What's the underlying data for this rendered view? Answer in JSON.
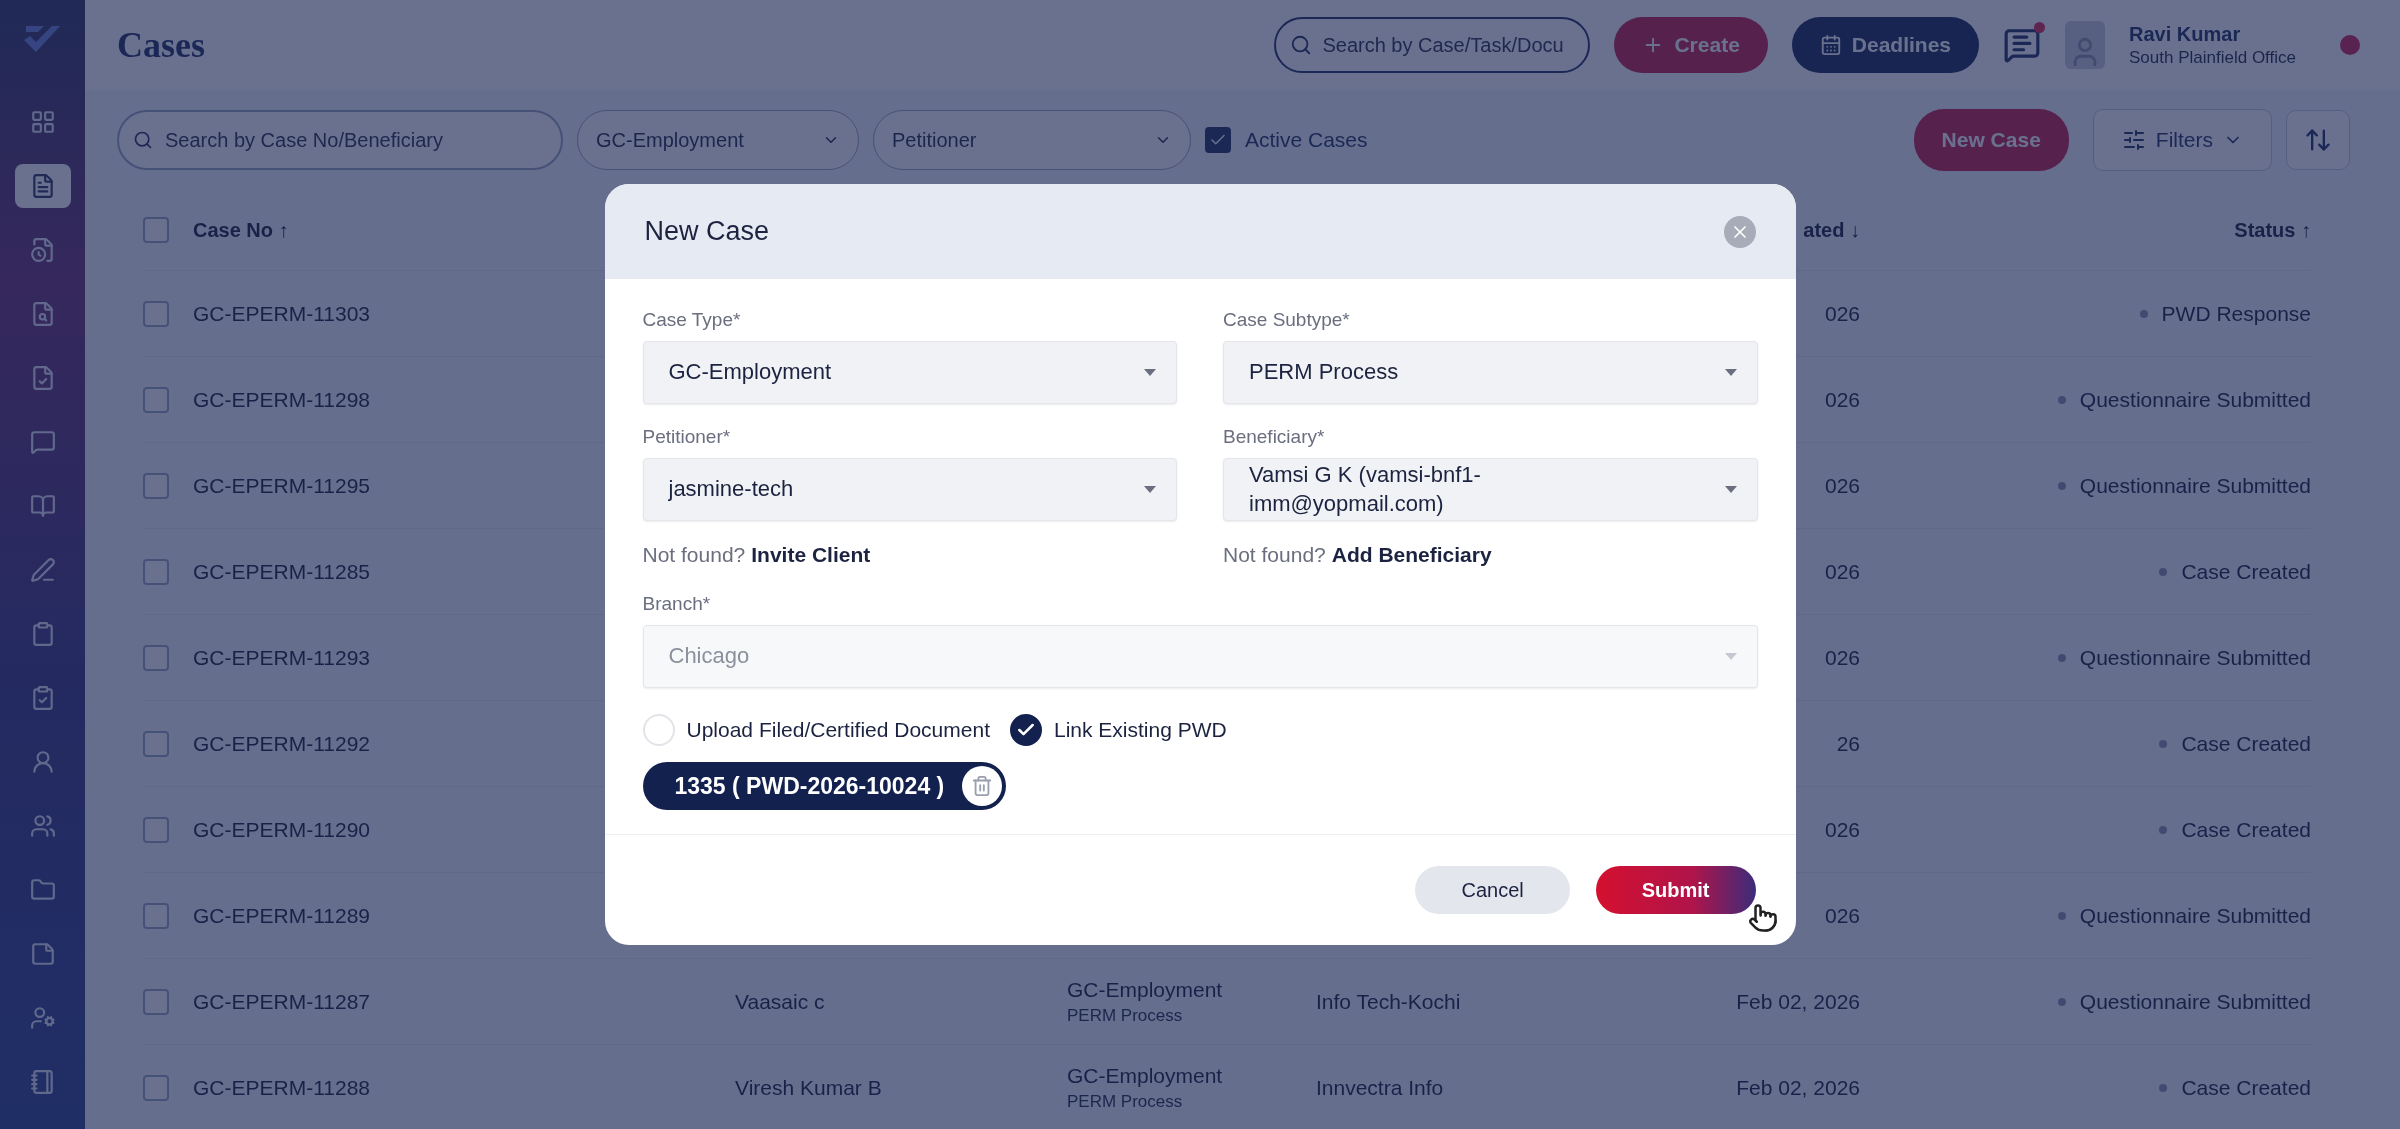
{
  "topbar": {
    "title": "Cases",
    "search": {
      "placeholder": "Search by Case/Task/Docu"
    },
    "create_button": "Create",
    "deadlines_button": "Deadlines",
    "chat": {
      "unread": true
    },
    "user": {
      "name": "Ravi Kumar",
      "office": "South Plainfield Office"
    }
  },
  "sidebar": {
    "items": [
      {
        "selected": false
      },
      {
        "selected": true
      },
      {
        "selected": false
      },
      {
        "selected": false
      },
      {
        "selected": false
      },
      {
        "selected": false
      },
      {
        "selected": false
      },
      {
        "selected": false
      },
      {
        "selected": false
      },
      {
        "selected": false
      },
      {
        "selected": false
      },
      {
        "selected": false
      },
      {
        "selected": false
      },
      {
        "selected": false
      },
      {
        "selected": false
      },
      {
        "selected": false
      }
    ]
  },
  "filters": {
    "search": {
      "placeholder": "Search by Case No/Beneficiary"
    },
    "case_type": {
      "value": "GC-Employment"
    },
    "petitioner": {
      "placeholder": "Petitioner"
    },
    "active_cases": {
      "label": "Active Cases",
      "checked": true
    },
    "new_case_button": "New Case",
    "filters_button": "Filters"
  },
  "table": {
    "columns": {
      "case_no": "Case No ↑",
      "created": "ated ↓",
      "status": "Status ↑"
    },
    "header_checked": false,
    "rows": [
      {
        "checked": false,
        "case_no": "GC-EPERM-11303",
        "created": "026",
        "status": "PWD Response"
      },
      {
        "checked": false,
        "case_no": "GC-EPERM-11298",
        "created": "026",
        "status": "Questionnaire Submitted"
      },
      {
        "checked": false,
        "case_no": "GC-EPERM-11295",
        "created": "026",
        "status": "Questionnaire Submitted"
      },
      {
        "checked": false,
        "case_no": "GC-EPERM-11285",
        "created": "026",
        "status": "Case Created"
      },
      {
        "checked": false,
        "case_no": "GC-EPERM-11293",
        "created": "026",
        "status": "Questionnaire Submitted"
      },
      {
        "checked": false,
        "case_no": "GC-EPERM-11292",
        "created": "26",
        "status": "Case Created"
      },
      {
        "checked": false,
        "case_no": "GC-EPERM-11290",
        "created": "026",
        "status": "Case Created"
      },
      {
        "checked": false,
        "case_no": "GC-EPERM-11289",
        "created": "026",
        "status": "Questionnaire Submitted"
      },
      {
        "checked": false,
        "case_no": "GC-EPERM-11287",
        "beneficiary": "Vaasaic c",
        "case_type": "GC-Employment",
        "case_subtype": "PERM Process",
        "petitioner": "Info Tech-Kochi",
        "created": "Feb 02, 2026",
        "status": "Questionnaire Submitted"
      },
      {
        "checked": false,
        "case_no": "GC-EPERM-11288",
        "beneficiary": "Viresh Kumar B",
        "case_type": "GC-Employment",
        "case_subtype": "PERM Process",
        "petitioner": "Innvectra Info",
        "created": "Feb 02, 2026",
        "status": "Case Created"
      }
    ]
  },
  "modal": {
    "title": "New Case",
    "fields": [
      {
        "label": "Case Type*",
        "value": "GC-Employment",
        "disabled": false,
        "wide": false
      },
      {
        "label": "Case Subtype*",
        "value": "PERM Process",
        "disabled": false,
        "wide": false
      },
      {
        "label": "Petitioner*",
        "value": "jasmine-tech",
        "disabled": false,
        "wide": false
      },
      {
        "label": "Beneficiary*",
        "value": "Vamsi G K (vamsi-bnf1-imm@yopmail.com)",
        "disabled": false,
        "wide": false
      }
    ],
    "notes": [
      {
        "text": "Not found?",
        "link": "Invite Client"
      },
      {
        "text": "Not found?",
        "link": "Add Beneficiary"
      }
    ],
    "branch": {
      "label": "Branch*",
      "value": "Chicago",
      "disabled": true,
      "wide": true
    },
    "options": [
      {
        "label": "Upload Filed/Certified Document",
        "checked": false
      },
      {
        "label": "Link Existing PWD",
        "checked": true
      }
    ],
    "chip": "1335 ( PWD-2026-10024 )",
    "cancel_button": "Cancel",
    "submit_button": "Submit"
  }
}
